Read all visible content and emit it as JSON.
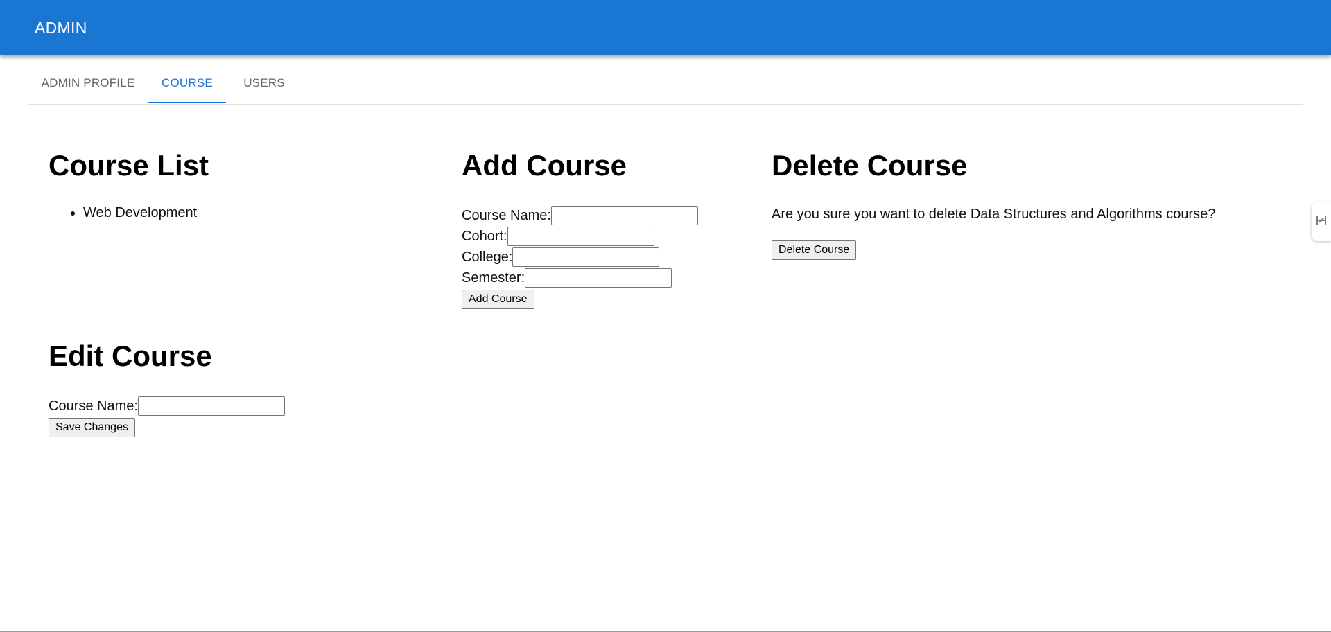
{
  "appbar": {
    "title": "ADMIN"
  },
  "tabs": [
    {
      "label": "ADMIN PROFILE",
      "active": false
    },
    {
      "label": "COURSE",
      "active": true
    },
    {
      "label": "USERS",
      "active": false
    }
  ],
  "colors": {
    "primary": "#1976d2",
    "tab_inactive": "#666666"
  },
  "course_list": {
    "title": "Course List",
    "items": [
      "Web Development"
    ]
  },
  "add_course": {
    "title": "Add Course",
    "fields": [
      {
        "label": "Course Name:",
        "value": ""
      },
      {
        "label": "Cohort:",
        "value": ""
      },
      {
        "label": "College:",
        "value": ""
      },
      {
        "label": "Semester:",
        "value": ""
      }
    ],
    "button": "Add Course"
  },
  "delete_course": {
    "title": "Delete Course",
    "message": "Are you sure you want to delete Data Structures and Algorithms course?",
    "button": "Delete Course"
  },
  "edit_course": {
    "title": "Edit Course",
    "fields": [
      {
        "label": "Course Name:",
        "value": ""
      }
    ],
    "button": "Save Changes"
  },
  "side_handle": {
    "icon": "collapse-handle-icon"
  }
}
